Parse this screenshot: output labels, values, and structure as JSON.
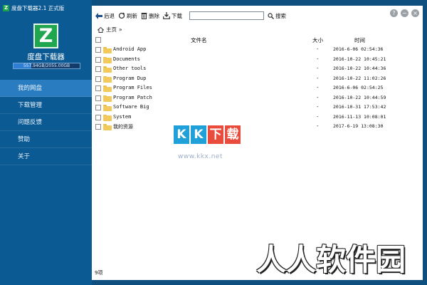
{
  "app": {
    "title": "度盘下载器2.1 正式版",
    "logo_letter": "Z",
    "name": "度盘下载器",
    "storage_text": "557.94GB/2055.00GB",
    "storage_fraction": 0.27
  },
  "nav": [
    {
      "label": "我的网盘",
      "active": true
    },
    {
      "label": "下载管理",
      "active": false
    },
    {
      "label": "问题反馈",
      "active": false
    },
    {
      "label": "赞助",
      "active": false
    },
    {
      "label": "关于",
      "active": false
    }
  ],
  "toolbar": {
    "back_label": "后退",
    "refresh_label": "刷新",
    "delete_label": "删除",
    "download_label": "下载",
    "search_value": "",
    "search_button": "搜索"
  },
  "window_controls": {
    "help": "?",
    "minimize": "−",
    "close": "×"
  },
  "breadcrumb": {
    "label": "主页",
    "separator": "»"
  },
  "table": {
    "headers": {
      "name": "文件名",
      "size": "大小",
      "time": "时间"
    },
    "rows": [
      {
        "name": "Android App",
        "size": "-",
        "time": "2016-6-06 02:54:36"
      },
      {
        "name": "Documents",
        "size": "-",
        "time": "2016-10-22 10:45:21"
      },
      {
        "name": "Other tools",
        "size": "-",
        "time": "2016-10-22 10:44:36"
      },
      {
        "name": "Program Dup",
        "size": "-",
        "time": "2016-10-22 11:02:26"
      },
      {
        "name": "Program Files",
        "size": "-",
        "time": "2016-6-06 02:54:25"
      },
      {
        "name": "Program Patch",
        "size": "-",
        "time": "2016-10-22 10:44:59"
      },
      {
        "name": "Software Big",
        "size": "-",
        "time": "2016-10-31 17:53:42"
      },
      {
        "name": "System",
        "size": "-",
        "time": "2016-11-13 10:08:01"
      },
      {
        "name": "我的资源",
        "size": "-",
        "time": "2017-6-19 13:08:30"
      }
    ]
  },
  "status": {
    "count": "9项"
  },
  "watermark": {
    "chars": [
      "K",
      "K",
      "下",
      "载"
    ],
    "url": "www.kkx.net"
  },
  "corner_watermark": {
    "text": "人人软件园"
  }
}
